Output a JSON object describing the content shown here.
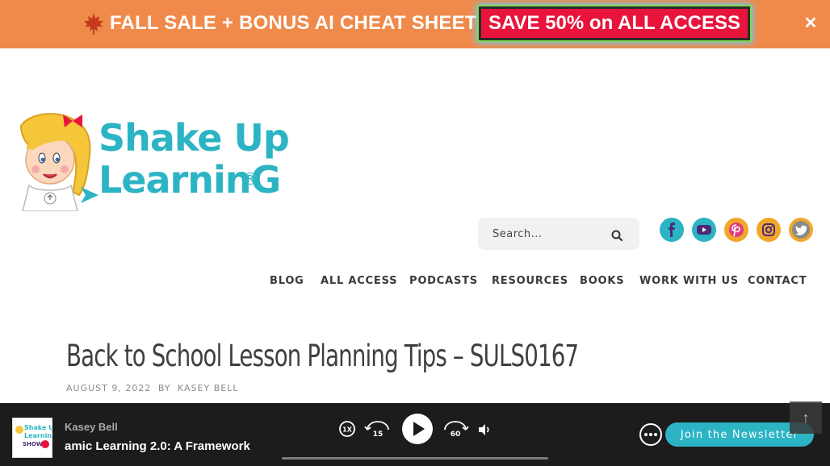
{
  "promo": {
    "leaf_icon": "maple-leaf-icon",
    "text": "FALL SALE + BONUS AI CHEAT SHEETS",
    "cta": "SAVE 50% on ALL ACCESS",
    "close": "✕",
    "colors": {
      "banner": "#f08a4b",
      "cta": "#e8143c"
    }
  },
  "logo": {
    "line1": "Shake Up",
    "line2": "LearninG",
    "reg": "®"
  },
  "search": {
    "placeholder": "Search...",
    "icon": "search-icon"
  },
  "social": [
    {
      "name": "facebook-icon",
      "color": "#2cb4c4"
    },
    {
      "name": "youtube-icon",
      "color": "#4b2a7a"
    },
    {
      "name": "pinterest-icon",
      "color": "#e03c7c"
    },
    {
      "name": "instagram-icon",
      "color": "#f2a72a"
    },
    {
      "name": "twitter-icon",
      "color": "#888888"
    }
  ],
  "nav": {
    "items": [
      "BLOG",
      "ALL ACCESS",
      "PODCASTS",
      "RESOURCES",
      "BOOKS",
      "WORK WITH US",
      "CONTACT"
    ]
  },
  "post": {
    "title": "Back to School Lesson Planning Tips – SULS0167",
    "date": "AUGUST 9, 2022",
    "by": "BY",
    "author": "KASEY BELL"
  },
  "player": {
    "host": "Kasey Bell",
    "episode": "amic Learning 2.0: A Framework",
    "speed": "1X",
    "rewind": "15",
    "forward": "60",
    "progress": 0.0,
    "newsletter": "Join the Newsletter",
    "art": {
      "line1": "Shake Up",
      "line2": "Learning",
      "line3": "SHOW"
    }
  },
  "scrolltop": "↑"
}
